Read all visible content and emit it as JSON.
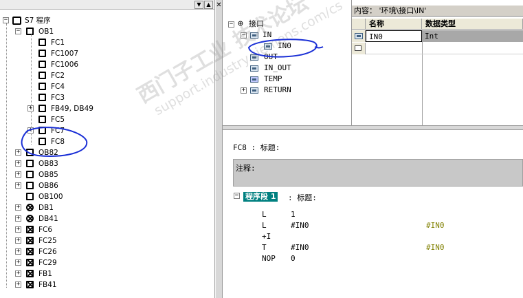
{
  "tree": {
    "root": "S7 程序",
    "items": [
      {
        "label": "OB1",
        "type": "plain",
        "expanded": true
      },
      {
        "label": "FC1",
        "type": "plain"
      },
      {
        "label": "FC1007",
        "type": "plain"
      },
      {
        "label": "FC1006",
        "type": "plain"
      },
      {
        "label": "FC2",
        "type": "plain"
      },
      {
        "label": "FC4",
        "type": "plain"
      },
      {
        "label": "FC3",
        "type": "plain"
      },
      {
        "label": "FB49, DB49",
        "type": "plain"
      },
      {
        "label": "FC5",
        "type": "plain"
      },
      {
        "label": "FC7",
        "type": "plain"
      },
      {
        "label": "FC8",
        "type": "plain"
      },
      {
        "label": "OB82",
        "type": "plain"
      },
      {
        "label": "OB83",
        "type": "plain"
      },
      {
        "label": "OB85",
        "type": "plain"
      },
      {
        "label": "OB86",
        "type": "plain"
      },
      {
        "label": "OB100",
        "type": "plain"
      },
      {
        "label": "DB1",
        "type": "db"
      },
      {
        "label": "DB41",
        "type": "db"
      },
      {
        "label": "FC6",
        "type": "x"
      },
      {
        "label": "FC25",
        "type": "x"
      },
      {
        "label": "FC26",
        "type": "x"
      },
      {
        "label": "FC29",
        "type": "x"
      },
      {
        "label": "FB1",
        "type": "x"
      },
      {
        "label": "FB41",
        "type": "x"
      }
    ]
  },
  "interface": {
    "root": "接口",
    "items": [
      {
        "label": "IN"
      },
      {
        "label": "IN0"
      },
      {
        "label": "OUT"
      },
      {
        "label": "IN_OUT"
      },
      {
        "label": "TEMP"
      },
      {
        "label": "RETURN"
      }
    ]
  },
  "properties": {
    "header": "内容： '环境\\接口\\IN'",
    "col_name": "名称",
    "col_type": "数据类型",
    "rows": [
      {
        "name": "IN0",
        "type": "Int"
      }
    ]
  },
  "code": {
    "block_title": "FC8 : 标题:",
    "comment_label": "注释:",
    "network_label": "程序段 1",
    "network_title": ": 标题:",
    "lines": [
      {
        "op": "L",
        "arg": "1",
        "comment": ""
      },
      {
        "op": "L",
        "arg": "#IN0",
        "comment": "#IN0"
      },
      {
        "op": "+I",
        "arg": "",
        "comment": ""
      },
      {
        "op": "T",
        "arg": "#IN0",
        "comment": "#IN0"
      },
      {
        "op": "NOP",
        "arg": "0",
        "comment": ""
      }
    ],
    "comment_color": "#808000"
  },
  "watermark": {
    "line1": "西门子工业 技术论坛",
    "line2": "support.industry.siemens.com/cs"
  },
  "colors": {
    "annotation_ink": "#1a2fd6",
    "network_bg": "#008080"
  }
}
